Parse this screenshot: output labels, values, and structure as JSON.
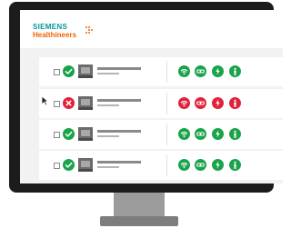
{
  "logo": {
    "line1": "SIEMENS",
    "line2": "Healthineers"
  },
  "colors": {
    "ok": "#1aa34a",
    "error": "#e0233c",
    "brand_teal": "#009999",
    "brand_orange": "#ec6602"
  },
  "rows": [
    {
      "status": "ok",
      "checked": false,
      "icons": [
        "wifi-icon",
        "link-icon",
        "power-icon",
        "person-icon"
      ],
      "icon_status": "ok"
    },
    {
      "status": "error",
      "checked": false,
      "icons": [
        "wifi-icon",
        "link-icon",
        "power-icon",
        "person-icon"
      ],
      "icon_status": "error"
    },
    {
      "status": "ok",
      "checked": false,
      "icons": [
        "wifi-icon",
        "link-icon",
        "power-icon",
        "person-icon"
      ],
      "icon_status": "ok"
    },
    {
      "status": "ok",
      "checked": false,
      "icons": [
        "wifi-icon",
        "link-icon",
        "power-icon",
        "person-icon"
      ],
      "icon_status": "ok"
    }
  ]
}
